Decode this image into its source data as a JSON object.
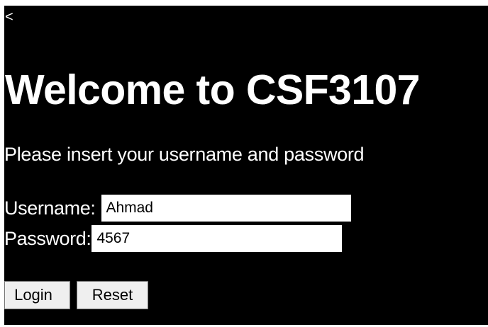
{
  "nav": {
    "back_label": "<"
  },
  "header": {
    "title": "Welcome to CSF3107"
  },
  "main": {
    "instructions": "Please insert your username and password"
  },
  "form": {
    "username": {
      "label": "Username:",
      "value": "Ahmad"
    },
    "password": {
      "label": "Password:",
      "value": "4567"
    }
  },
  "buttons": {
    "login_label": "Login",
    "reset_label": "Reset"
  },
  "colors": {
    "background": "#000000",
    "text": "#ffffff",
    "input_background": "#ffffff",
    "button_background": "#efefef"
  }
}
